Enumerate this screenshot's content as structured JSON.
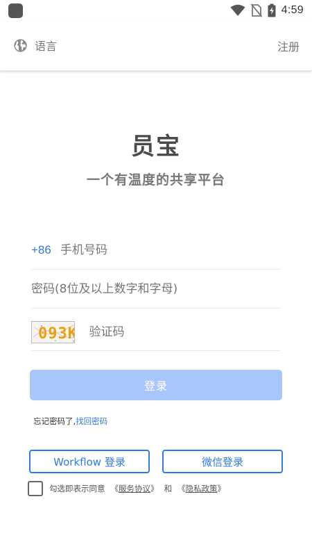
{
  "status_bar": {
    "time": "4:59",
    "icons": [
      "app-icon",
      "wifi-icon",
      "no-sim-icon",
      "battery-charging-icon"
    ]
  },
  "topbar": {
    "language_label": "语言",
    "language_icon": "globe-icon",
    "register_label": "注册"
  },
  "brand": {
    "title": "员宝",
    "slogan": "一个有温度的共享平台"
  },
  "form": {
    "country_code": "+86",
    "phone_placeholder": "手机号码",
    "password_placeholder": "密码(8位及以上数字和字母)",
    "captcha_text": "093K",
    "captcha_placeholder": "验证码",
    "login_label": "登录"
  },
  "forgot": {
    "prefix": "忘记密码了,",
    "link": "找回密码"
  },
  "alt_login": {
    "workflow_label": "Workflow 登录",
    "wechat_label": "微信登录"
  },
  "agreement": {
    "prefix": "勾选即表示同意",
    "service_open": "《",
    "service_link": "服务协议",
    "service_close": "》",
    "and": "和",
    "privacy_open": "《",
    "privacy_link": "隐私政策",
    "privacy_close": "》"
  },
  "colors": {
    "accent": "#2f7ae5",
    "login_button_disabled": "#a8c6f9",
    "text_muted": "#777777"
  }
}
